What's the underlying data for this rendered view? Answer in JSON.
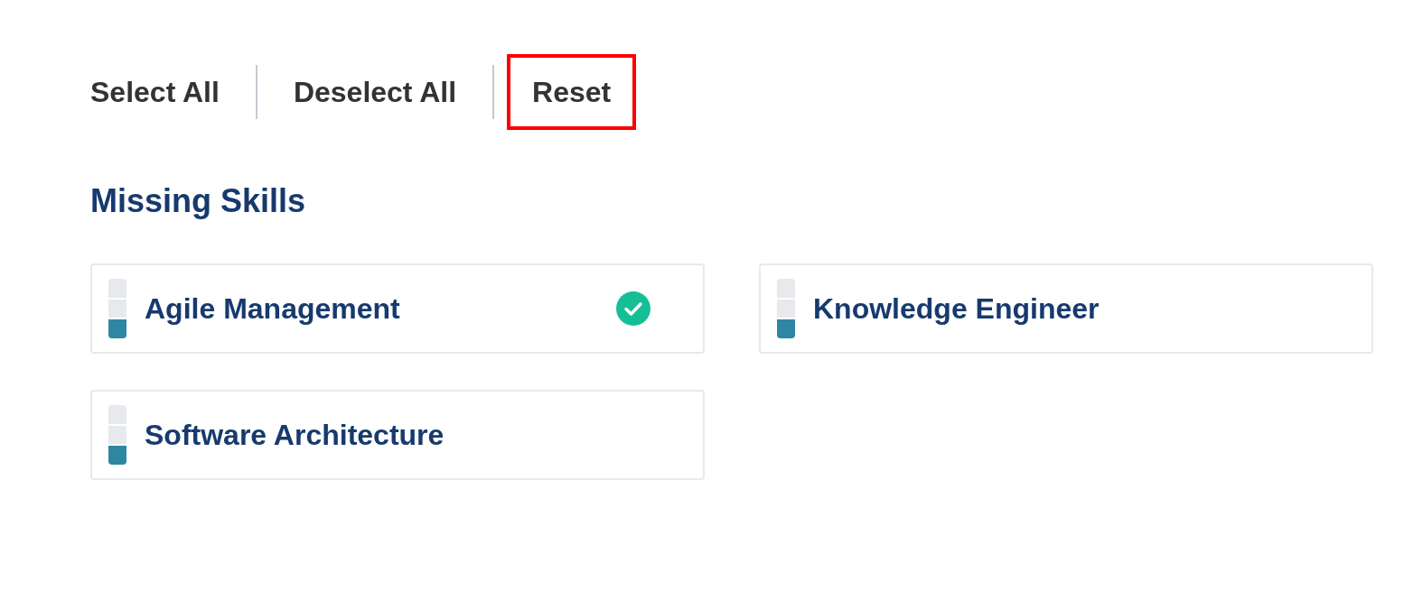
{
  "actions": [
    {
      "label": "Select All",
      "highlighted": false
    },
    {
      "label": "Deselect All",
      "highlighted": false
    },
    {
      "label": "Reset",
      "highlighted": true
    }
  ],
  "section": {
    "title": "Missing Skills"
  },
  "skills": [
    {
      "name": "Agile Management",
      "level": 0.33,
      "checked": true
    },
    {
      "name": "Knowledge Engineer",
      "level": 0.33,
      "checked": false
    },
    {
      "name": "Software Architecture",
      "level": 0.33,
      "checked": false
    }
  ]
}
